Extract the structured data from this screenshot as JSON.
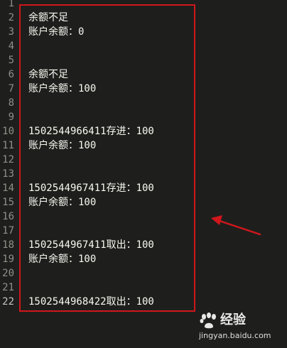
{
  "editor": {
    "lines": [
      {
        "number": "1",
        "text": ""
      },
      {
        "number": "2",
        "text": "余额不足"
      },
      {
        "number": "3",
        "text": "账户余额：0"
      },
      {
        "number": "4",
        "text": ""
      },
      {
        "number": "5",
        "text": ""
      },
      {
        "number": "6",
        "text": "余额不足"
      },
      {
        "number": "7",
        "text": "账户余额：100"
      },
      {
        "number": "8",
        "text": ""
      },
      {
        "number": "9",
        "text": ""
      },
      {
        "number": "10",
        "text": "1502544966411存进：100"
      },
      {
        "number": "11",
        "text": "账户余额：100"
      },
      {
        "number": "12",
        "text": ""
      },
      {
        "number": "13",
        "text": ""
      },
      {
        "number": "14",
        "text": "1502544967411存进：100"
      },
      {
        "number": "15",
        "text": "账户余额：100"
      },
      {
        "number": "16",
        "text": ""
      },
      {
        "number": "17",
        "text": ""
      },
      {
        "number": "18",
        "text": "1502544967411取出：100"
      },
      {
        "number": "19",
        "text": "账户余额：100"
      },
      {
        "number": "20",
        "text": ""
      },
      {
        "number": "21",
        "text": ""
      },
      {
        "number": "22",
        "text": "1502544968422取出：100"
      }
    ],
    "current_line": "22"
  },
  "annotation": {
    "box_color": "#d0161c",
    "arrow_color": "#d0161c",
    "arrow_icon": "arrow-left-icon"
  },
  "watermark": {
    "brand": "经验",
    "url": "jingyan.baidu.com",
    "logo_icon": "baidu-paw-icon"
  },
  "colors": {
    "background": "#1e1f1c",
    "text": "#f8f8f2",
    "line_number": "#8f908a"
  }
}
